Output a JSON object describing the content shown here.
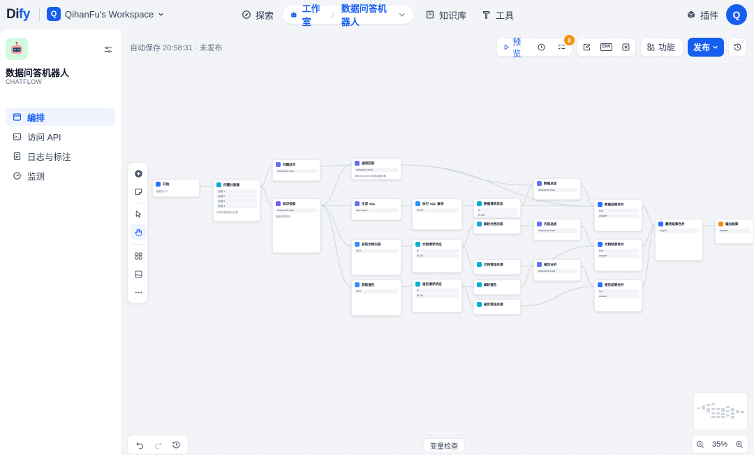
{
  "nav": {
    "logo_a": "Di",
    "logo_b": "fy",
    "workspace_initial": "Q",
    "workspace_name": "QihanFu's Workspace",
    "explore": "探索",
    "studio": "工作室",
    "current_app": "数据问答机器人",
    "knowledge": "知识库",
    "tools": "工具",
    "plugins": "插件",
    "avatar_initial": "Q"
  },
  "sidebar": {
    "app_name": "数据问答机器人",
    "app_type": "CHATFLOW",
    "items": [
      {
        "label": "编排",
        "icon": "layout-icon",
        "active": true
      },
      {
        "label": "访问 API",
        "icon": "terminal-icon",
        "active": false
      },
      {
        "label": "日志与标注",
        "icon": "log-icon",
        "active": false
      },
      {
        "label": "监测",
        "icon": "monitor-icon",
        "active": false
      }
    ]
  },
  "toolbar": {
    "autosave": "自动保存 20:58:31 · 未发布",
    "preview": "预览",
    "checklist_count": "8",
    "env_label": "ENV",
    "features": "功能",
    "publish": "发布"
  },
  "canvas": {
    "variable_inspect": "变量检查",
    "zoom": "35%"
  },
  "nodes": [
    {
      "id": "start",
      "title": "开始",
      "color": "#2970ff",
      "desc": "流程的入口",
      "lines": []
    },
    {
      "id": "classify",
      "title": "问题分类器",
      "color": "#06aed4",
      "desc": "对用户提问进行分类",
      "lines": [
        "分类 1",
        "分类 2",
        "分类 3",
        "分类 4"
      ]
    },
    {
      "id": "knowledge",
      "title": "知识检索",
      "color": "#7a5af8",
      "desc": "检索相关知识",
      "lines": [
        "deepseek-chat"
      ]
    },
    {
      "id": "llm_rewrite",
      "title": "问题改写",
      "color": "#6172f3",
      "desc": "",
      "lines": [
        "deepseek-chat"
      ]
    },
    {
      "id": "general",
      "title": "通用回答",
      "color": "#6172f3",
      "desc": "使用 DeepSeek 回答通用问题",
      "lines": [
        "deepseek-chat"
      ]
    },
    {
      "id": "sql_gen",
      "title": "生成 SQL",
      "color": "#6172f3",
      "desc": "",
      "lines": [
        "qwen-plus"
      ]
    },
    {
      "id": "exec_sql",
      "title": "执行 SQL 查询",
      "color": "#2e90fa",
      "desc": "",
      "lines": [
        "POST"
      ]
    },
    {
      "id": "fetch_doc",
      "title": "获取文档内容",
      "color": "#2e90fa",
      "desc": "",
      "lines": [
        "GET"
      ]
    },
    {
      "id": "fetch_report",
      "title": "获取报告",
      "color": "#2e90fa",
      "desc": "",
      "lines": [
        "GET"
      ]
    },
    {
      "id": "doc_req",
      "title": "文档请求状态",
      "color": "#06aed4",
      "desc": "",
      "lines": [
        "IF",
        "ELSE"
      ]
    },
    {
      "id": "rep_req",
      "title": "报告请求状态",
      "color": "#06aed4",
      "desc": "",
      "lines": [
        "IF",
        "ELSE"
      ]
    },
    {
      "id": "data_req",
      "title": "数据请求状态",
      "color": "#06aed4",
      "desc": "",
      "lines": [
        "IF",
        "ELSE"
      ]
    },
    {
      "id": "parse_doc",
      "title": "解析文档内容",
      "color": "#06aed4",
      "desc": "",
      "lines": []
    },
    {
      "id": "doc_err",
      "title": "文档错误处理",
      "color": "#06aed4",
      "desc": "",
      "lines": []
    },
    {
      "id": "parse_rep",
      "title": "解析报告",
      "color": "#06aed4",
      "desc": "",
      "lines": []
    },
    {
      "id": "rep_err",
      "title": "报告错误处理",
      "color": "#06aed4",
      "desc": "",
      "lines": []
    },
    {
      "id": "data_sum",
      "title": "数据总结",
      "color": "#6172f3",
      "desc": "",
      "lines": [
        "deepseek-chat"
      ]
    },
    {
      "id": "content_sum",
      "title": "内容总结",
      "color": "#6172f3",
      "desc": "",
      "lines": [
        "deepseek-chat"
      ]
    },
    {
      "id": "rep_analysis",
      "title": "报告分析",
      "color": "#6172f3",
      "desc": "",
      "lines": [
        "deepseek-chat"
      ]
    },
    {
      "id": "data_merge",
      "title": "数据结果合并",
      "color": "#2970ff",
      "desc": "",
      "lines": [
        "text",
        "answer"
      ]
    },
    {
      "id": "doc_merge",
      "title": "文档结果合并",
      "color": "#2970ff",
      "desc": "",
      "lines": [
        "text",
        "answer"
      ]
    },
    {
      "id": "rep_merge",
      "title": "报告结果合并",
      "color": "#2970ff",
      "desc": "",
      "lines": [
        "text",
        "answer"
      ]
    },
    {
      "id": "final_merge",
      "title": "最终结果合并",
      "color": "#2970ff",
      "desc": "",
      "lines": [
        "output"
      ]
    },
    {
      "id": "answer",
      "title": "输出结果",
      "color": "#f79009",
      "desc": "",
      "lines": [
        "answer"
      ]
    }
  ]
}
